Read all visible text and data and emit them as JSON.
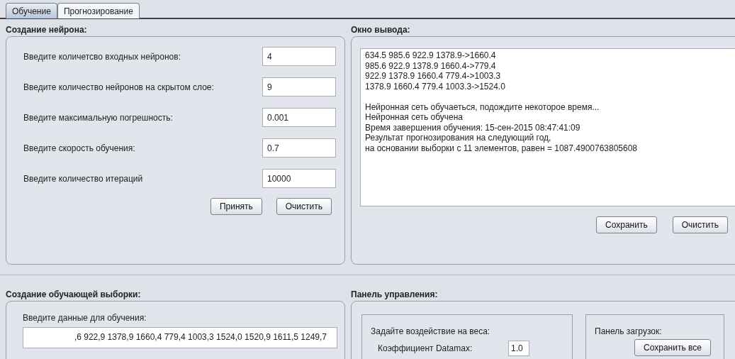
{
  "tabs": [
    {
      "label": "Обучение",
      "selected": true
    },
    {
      "label": "Прогнозирование",
      "selected": false
    }
  ],
  "neuron_panel": {
    "title": "Создание нейрона:",
    "fields": [
      {
        "label": "Введите количетсво входных нейронов:",
        "value": "4"
      },
      {
        "label": "Введите количество нейронов на скрытом слое:",
        "value": "9"
      },
      {
        "label": "Введите максимальную погрешность:",
        "value": "0.001"
      },
      {
        "label": "Введите скорость обучения:",
        "value": "0.7"
      },
      {
        "label": "Введите количество итераций",
        "value": "10000"
      }
    ],
    "buttons": [
      "Принять",
      "Очистить"
    ]
  },
  "output_panel": {
    "title": "Окно вывода:",
    "data_lines": [
      "634.5 985.6 922.9 1378.9->1660.4",
      "985.6 922.9 1378.9 1660.4->779.4",
      "922.9 1378.9 1660.4 779.4->1003.3",
      "1378.9 1660.4 779.4 1003.3->1524.0"
    ],
    "status_lines": [
      "Нейронная сеть обучаеться, подождите некоторое время...",
      "Нейронная сеть обучена",
      "Время завершения обучения: 15-сен-2015 08:47:41:09",
      "Результат прогнозирования на следующий год,",
      "на основании выборки с 11 элементов, равен = 1087.4900763805608"
    ],
    "buttons": [
      "Сохранить",
      "Очистить"
    ]
  },
  "sample_panel": {
    "title": "Создание обучающей выборки:",
    "label": "Введите данные для обучения:",
    "value": ",6 922,9 1378,9 1660,4 779,4 1003,3 1524,0 1520,9 1611,5 1249,7"
  },
  "control_panel": {
    "title": "Панель управления:",
    "weights": {
      "title": "Задайте воздействие на веса:",
      "label": "Коэффициент Datamax:",
      "value": "1.0"
    },
    "loads": {
      "title": "Панель загрузок:",
      "button": "Сохранить все"
    }
  }
}
